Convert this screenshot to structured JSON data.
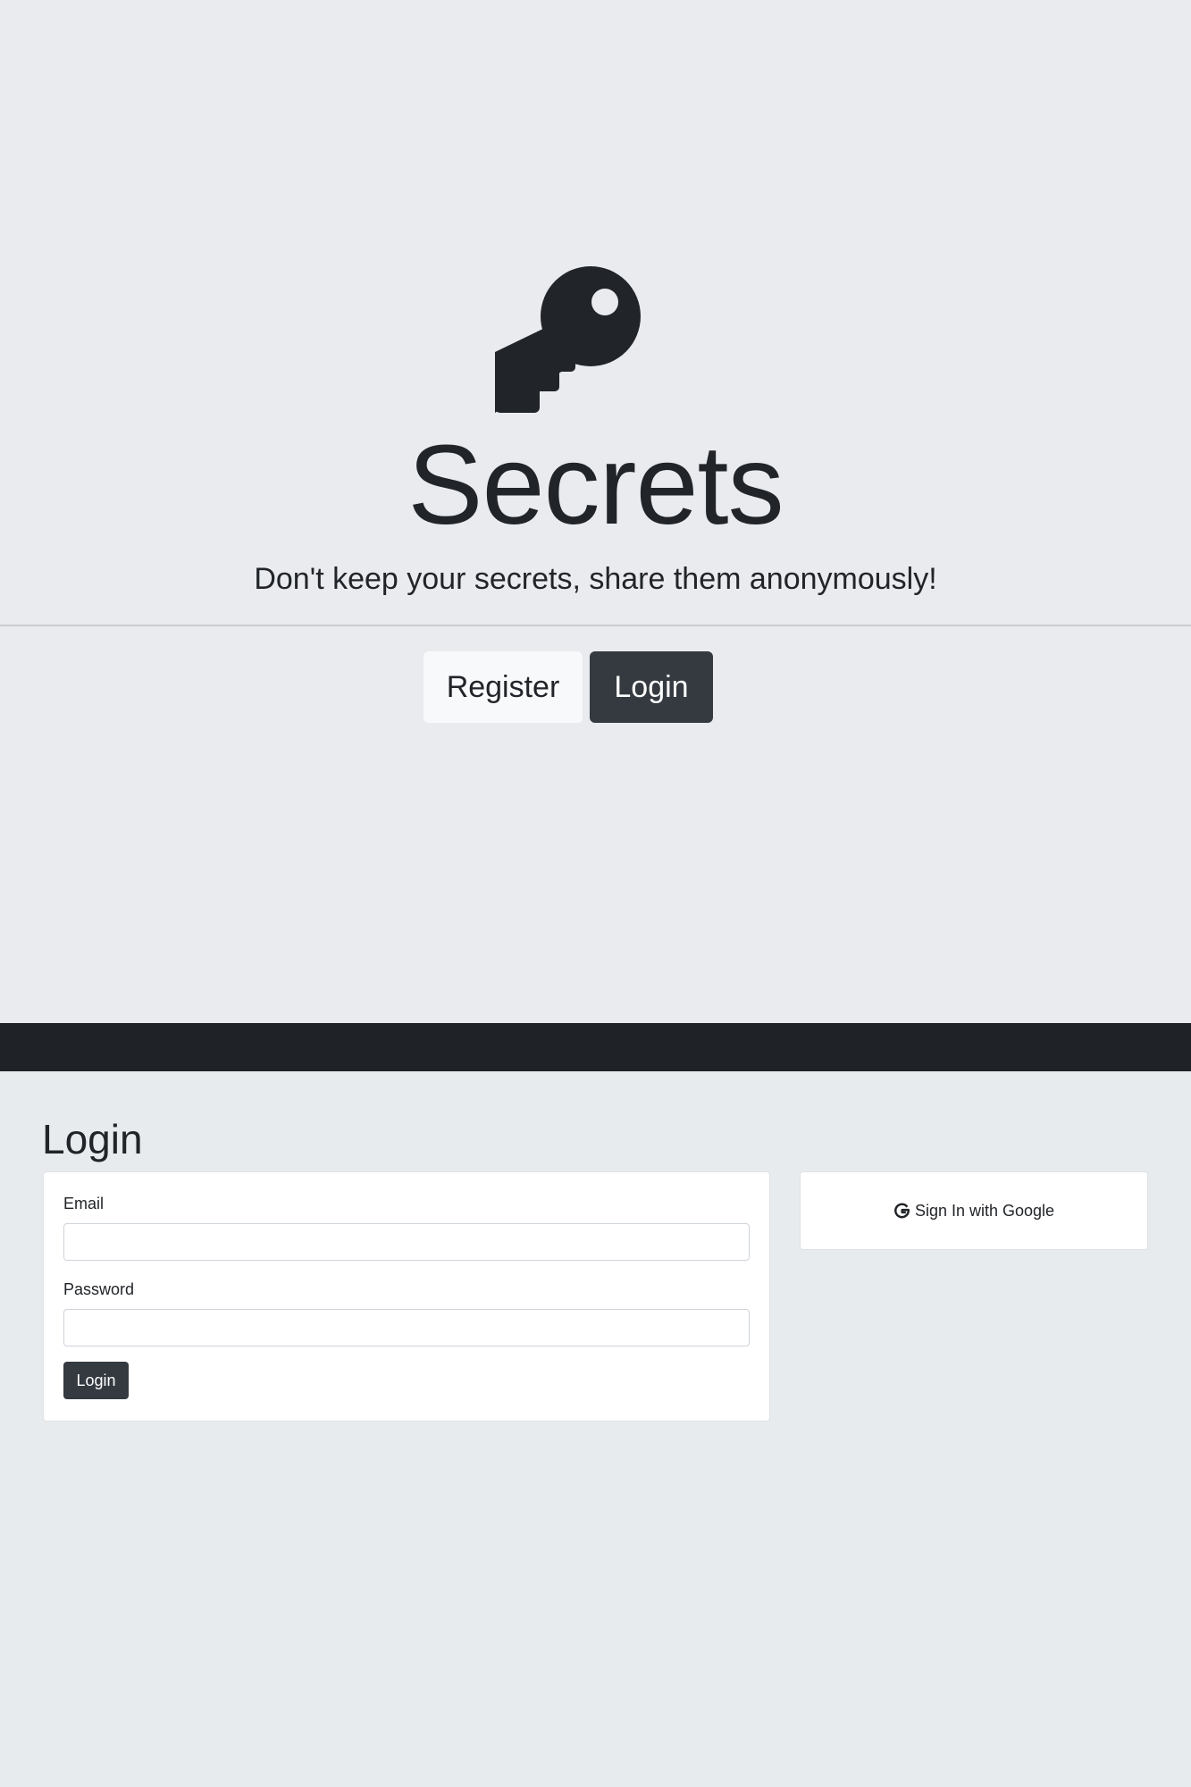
{
  "hero": {
    "icon": "key-icon",
    "title": "Secrets",
    "lead": "Don't keep your secrets, share them anonymously!",
    "register_label": "Register",
    "login_label": "Login"
  },
  "login_section": {
    "heading": "Login",
    "email_label": "Email",
    "email_value": "",
    "password_label": "Password",
    "password_value": "",
    "submit_label": "Login"
  },
  "google": {
    "icon": "google-icon",
    "label": "Sign In with Google"
  },
  "colors": {
    "hero_background": "#eaebef",
    "dark_band": "#1f2226",
    "page_background": "#e8ebee",
    "dark_button": "#343a40",
    "light_button": "#f8f9fa",
    "text": "#212529"
  }
}
